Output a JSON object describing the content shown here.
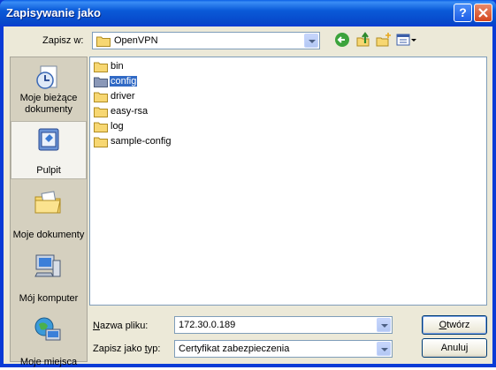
{
  "window": {
    "title": "Zapisywanie jako"
  },
  "toolbar": {
    "save_in_label": "Zapisz w:",
    "save_in_value": "OpenVPN"
  },
  "places": [
    {
      "label_line1": "Moje bieżące",
      "label_line2": "dokumenty",
      "icon": "recent-documents-icon"
    },
    {
      "label_line1": "Pulpit",
      "label_line2": "",
      "icon": "desktop-icon"
    },
    {
      "label_line1": "Moje dokumenty",
      "label_line2": "",
      "icon": "my-documents-icon"
    },
    {
      "label_line1": "Mój komputer",
      "label_line2": "",
      "icon": "my-computer-icon"
    },
    {
      "label_line1": "Moje miejsca",
      "label_line2": "",
      "icon": "network-places-icon"
    }
  ],
  "files": [
    {
      "name": "bin"
    },
    {
      "name": "config"
    },
    {
      "name": "driver"
    },
    {
      "name": "easy-rsa"
    },
    {
      "name": "log"
    },
    {
      "name": "sample-config"
    }
  ],
  "form": {
    "filename_label": "azwa pliku:",
    "filename_label_accel": "N",
    "filename_value": "172.30.0.189",
    "type_label_pre": "Zapisz jako ",
    "type_label_accel": "t",
    "type_label_post": "yp:",
    "type_value": "Certyfikat zabezpieczenia"
  },
  "buttons": {
    "open_accel": "O",
    "open_rest": "twórz",
    "cancel": "Anuluj"
  },
  "colors": {
    "titlebar": "#0a5ad8",
    "selection": "#316ac5",
    "dialog": "#ece9d8"
  }
}
